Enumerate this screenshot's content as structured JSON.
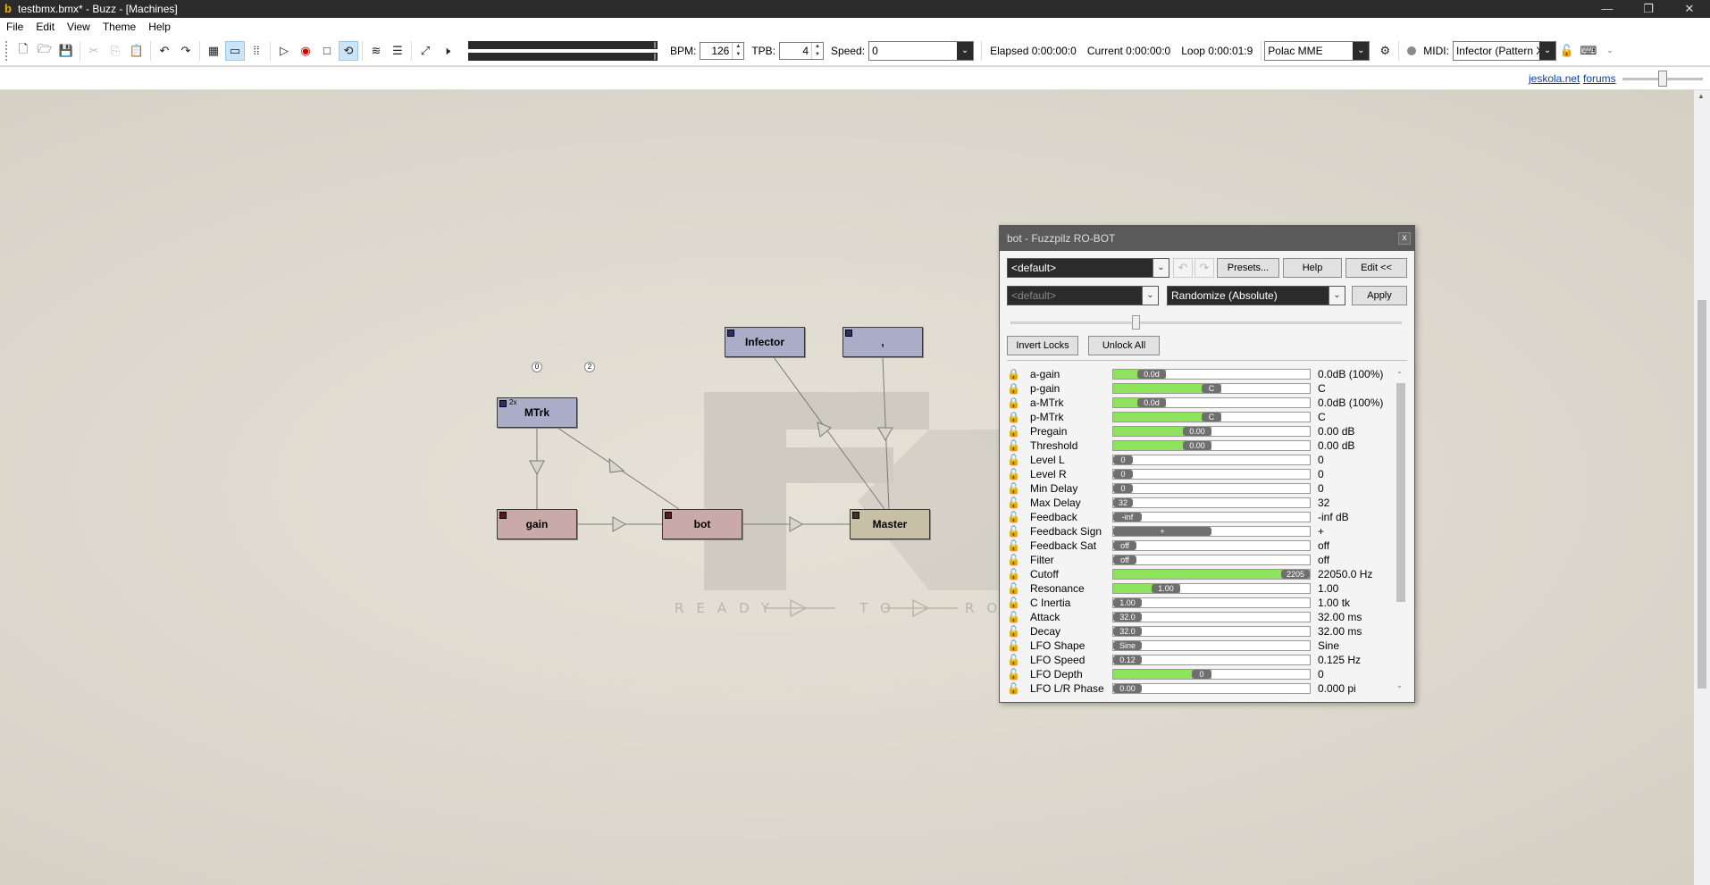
{
  "window": {
    "title": "testbmx.bmx* - Buzz - [Machines]",
    "app_icon": "buzz-b-icon",
    "controls": [
      "—",
      "❐",
      "✕"
    ]
  },
  "menu": [
    "File",
    "Edit",
    "View",
    "Theme",
    "Help"
  ],
  "toolbar": {
    "bpm_label": "BPM:",
    "bpm_value": "126",
    "tpb_label": "TPB:",
    "tpb_value": "4",
    "speed_label": "Speed:",
    "speed_value": "0",
    "elapsed": "Elapsed 0:00:00:0",
    "current": "Current 0:00:00:0",
    "loop": "Loop 0:00:01:9",
    "audio_driver": "Polac MME",
    "midi_label": "MIDI:",
    "midi_value": "Infector (Pattern X"
  },
  "links": {
    "jeskola": "jeskola.net",
    "forums": "forums"
  },
  "canvas": {
    "watermark_ready": "READY",
    "watermark_to": "TO",
    "watermark_ro": "RO",
    "machines": {
      "infector": "Infector",
      "comma": ",",
      "mtrk": "MTrk",
      "mtrk_tag": "2x",
      "gain": "gain",
      "bot": "bot",
      "master": "Master"
    },
    "badges": {
      "b0": "0",
      "b2": "2"
    }
  },
  "param_window": {
    "title": "bot - Fuzzpilz RO-BOT",
    "close": "x",
    "preset": "<default>",
    "presets_button": "Presets...",
    "help_button": "Help",
    "edit_button": "Edit <<",
    "preset2": "<default>",
    "randomize": "Randomize (Absolute)",
    "apply_button": "Apply",
    "invert_locks_button": "Invert Locks",
    "unlock_all_button": "Unlock All",
    "params": [
      {
        "name": "a-gain",
        "locked": true,
        "knob": "0.0d",
        "level": 0.27,
        "value": "0.0dB (100%)"
      },
      {
        "name": "p-gain",
        "locked": true,
        "knob": "C",
        "level": 0.55,
        "value": "C"
      },
      {
        "name": "a-MTrk",
        "locked": true,
        "knob": "0.0d",
        "level": 0.27,
        "value": "0.0dB (100%)"
      },
      {
        "name": "p-MTrk",
        "locked": true,
        "knob": "C",
        "level": 0.55,
        "value": "C"
      },
      {
        "name": "Pregain",
        "locked": false,
        "knob": "0.00",
        "level": 0.5,
        "value": "0.00 dB"
      },
      {
        "name": "Threshold",
        "locked": false,
        "knob": "0.00",
        "level": 0.5,
        "value": "0.00 dB"
      },
      {
        "name": "Level L",
        "locked": false,
        "knob": "0",
        "level": 0,
        "value": "0"
      },
      {
        "name": "Level R",
        "locked": false,
        "knob": "0",
        "level": 0,
        "value": "0"
      },
      {
        "name": "Min Delay",
        "locked": false,
        "knob": "0",
        "level": 0,
        "value": "0"
      },
      {
        "name": "Max Delay",
        "locked": false,
        "knob": "32",
        "level": 0,
        "value": "32"
      },
      {
        "name": "Feedback",
        "locked": false,
        "knob": "-inf",
        "level": 0,
        "value": "-inf dB"
      },
      {
        "name": "Feedback Sign",
        "locked": false,
        "knob": "+",
        "level": 0,
        "value": "+"
      },
      {
        "name": "Feedback Sat",
        "locked": false,
        "knob": "off",
        "level": 0,
        "value": "off"
      },
      {
        "name": "Filter",
        "locked": false,
        "knob": "off",
        "level": 0,
        "value": "off"
      },
      {
        "name": "Cutoff",
        "locked": false,
        "knob": "2205",
        "level": 1.0,
        "value": "22050.0 Hz"
      },
      {
        "name": "Resonance",
        "locked": false,
        "knob": "1.00",
        "level": 0.34,
        "value": "1.00"
      },
      {
        "name": "C Inertia",
        "locked": false,
        "knob": "1.00",
        "level": 0,
        "value": "1.00 tk"
      },
      {
        "name": "Attack",
        "locked": false,
        "knob": "32.0",
        "level": 0,
        "value": "32.00 ms"
      },
      {
        "name": "Decay",
        "locked": false,
        "knob": "32.0",
        "level": 0,
        "value": "32.00 ms"
      },
      {
        "name": "LFO Shape",
        "locked": false,
        "knob": "Sine",
        "level": 0,
        "value": "Sine"
      },
      {
        "name": "LFO Speed",
        "locked": false,
        "knob": "0.12",
        "level": 0,
        "value": "0.125 Hz"
      },
      {
        "name": "LFO Depth",
        "locked": false,
        "knob": "0",
        "level": 0.5,
        "value": "0"
      },
      {
        "name": "LFO L/R Phase",
        "locked": false,
        "knob": "0.00",
        "level": 0,
        "value": "0.000 pi"
      }
    ]
  }
}
